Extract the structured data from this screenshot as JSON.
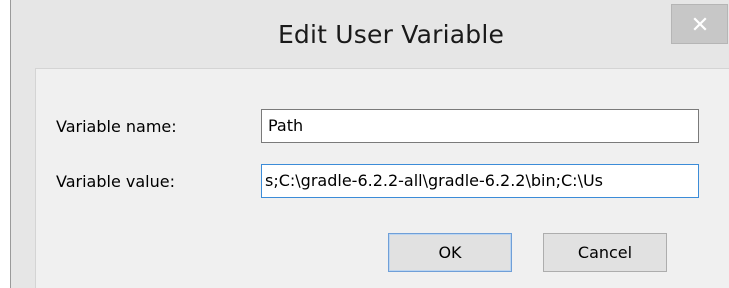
{
  "dialog": {
    "title": "Edit User Variable",
    "close_icon": "close-icon"
  },
  "form": {
    "name_label": "Variable name:",
    "name_value": "Path",
    "value_label": "Variable value:",
    "value_value": "s;C:\\gradle-6.2.2-all\\gradle-6.2.2\\bin;C:\\Us"
  },
  "buttons": {
    "ok_label": "OK",
    "cancel_label": "Cancel"
  },
  "colors": {
    "title_bar": "#e6e6e6",
    "panel": "#f0f0f0",
    "focus_border": "#3c8cd8",
    "close_button": "#c7c7c7"
  }
}
